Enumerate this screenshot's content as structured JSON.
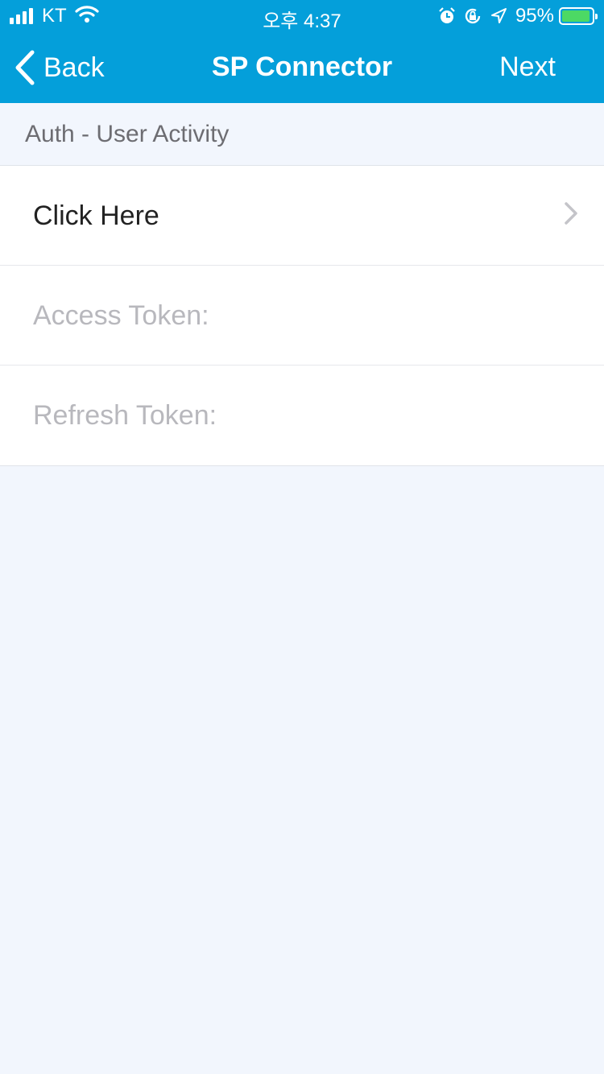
{
  "status_bar": {
    "carrier": "KT",
    "time": "오후 4:37",
    "battery_percent": "95%",
    "battery_level": 0.95,
    "battery_color": "#4cd964",
    "icons": [
      "signal-icon",
      "wifi-icon",
      "alarm-icon",
      "orientation-lock-icon",
      "location-icon",
      "battery-icon"
    ]
  },
  "nav": {
    "back_label": "Back",
    "title": "SP Connector",
    "next_label": "Next",
    "accent_color": "#049fda"
  },
  "section": {
    "header": "Auth - User Activity"
  },
  "rows": [
    {
      "label": "Click Here",
      "has_disclosure": true
    },
    {
      "label": "Access Token:",
      "placeholder": true
    },
    {
      "label": "Refresh Token:",
      "placeholder": true
    }
  ]
}
